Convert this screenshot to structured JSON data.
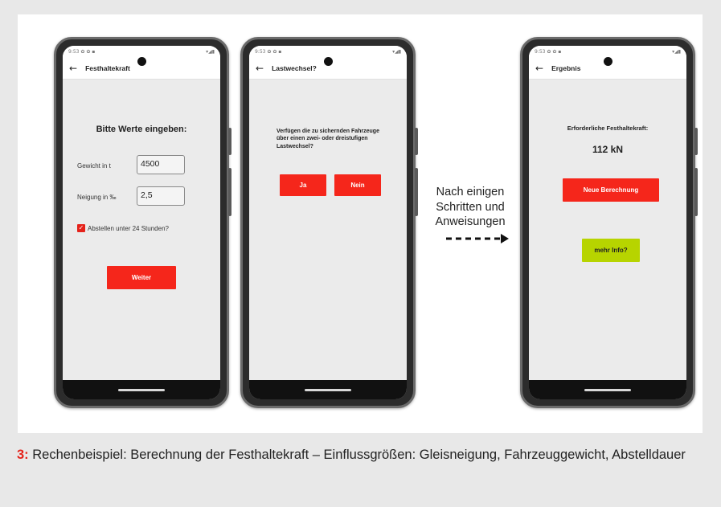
{
  "screens": [
    {
      "status_left": "9:53 ✿ ✿ ▪",
      "status_right": "▾◢▮",
      "back_icon": "arrow-left-icon",
      "title": "Festhaltekraft",
      "heading": "Bitte Werte eingeben:",
      "weight_label": "Gewicht in t",
      "weight_value": "4500",
      "slope_label": "Neigung in ‰",
      "slope_value": "2,5",
      "checkbox_checked": true,
      "checkbox_label": "Abstellen unter 24 Stunden?",
      "next_button": "Weiter"
    },
    {
      "status_left": "9:53 ✿ ✿ ▪",
      "status_right": "▾◢▮",
      "back_icon": "arrow-left-icon",
      "title": "Lastwechsel?",
      "question": "Verfügen die zu sichernden Fahrzeuge über einen zwei- oder dreistufigen Lastwechsel?",
      "yes_button": "Ja",
      "no_button": "Nein"
    },
    {
      "status_left": "9:53 ✿ ✿ ▪",
      "status_right": "▾◢▮",
      "back_icon": "arrow-left-icon",
      "title": "Ergebnis",
      "result_label": "Erforderliche Festhaltekraft:",
      "result_value": "112 kN",
      "new_calc_button": "Neue Berechnung",
      "more_info_button": "mehr Info?"
    }
  ],
  "transition": {
    "text_line1": "Nach einigen",
    "text_line2": "Schritten und",
    "text_line3": "Anweisungen",
    "arrow_icon": "dashed-arrow-right-icon"
  },
  "caption": {
    "number": "3:",
    "text": " Rechenbeispiel: Berechnung der Festhaltekraft – Einflussgrößen: Gleisneigung, Fahrzeuggewicht, Abstelldauer"
  },
  "colors": {
    "accent_red": "#f5261b",
    "accent_green": "#b7d400",
    "caption_number": "#e5221a"
  }
}
